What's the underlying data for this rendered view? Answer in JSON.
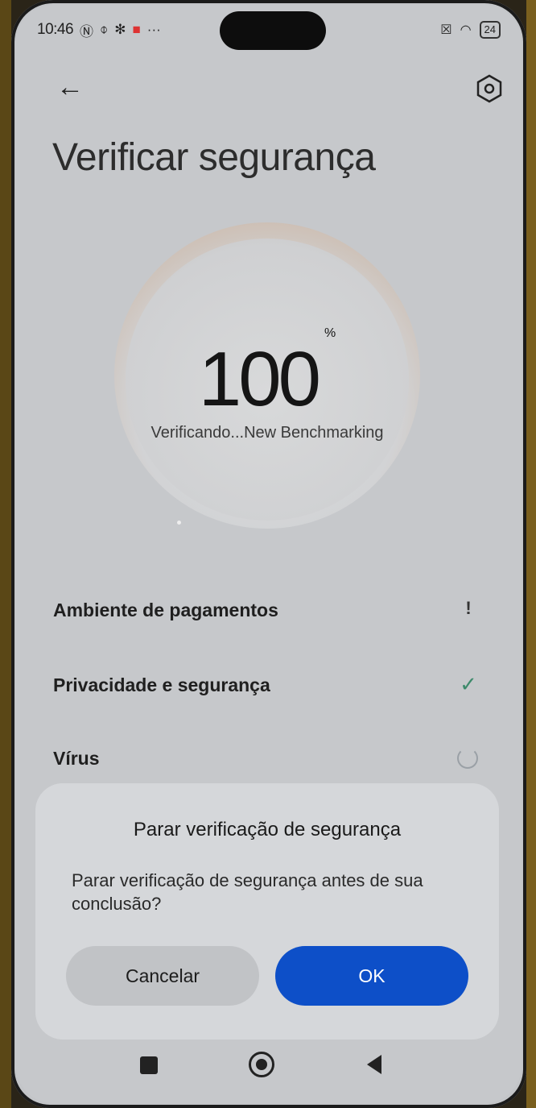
{
  "status_bar": {
    "time": "10:46",
    "battery": "24"
  },
  "header": {
    "title": "Verificar segurança"
  },
  "progress": {
    "value": "100",
    "unit": "%",
    "status_text": "Verificando...New Benchmarking"
  },
  "checks": [
    {
      "label": "Ambiente de pagamentos",
      "state": "warning",
      "icon": "exclamation-icon"
    },
    {
      "label": "Privacidade e segurança",
      "state": "done",
      "icon": "checkmark-icon"
    },
    {
      "label": "Vírus",
      "state": "in-progress",
      "icon": "spinner-icon"
    }
  ],
  "dialog": {
    "title": "Parar verificação de segurança",
    "message": "Parar verificação de segurança antes de sua conclusão?",
    "cancel_label": "Cancelar",
    "ok_label": "OK"
  },
  "colors": {
    "accent": "#0d4fc8",
    "success": "#3d8a6b",
    "ring": "#b06b40"
  }
}
